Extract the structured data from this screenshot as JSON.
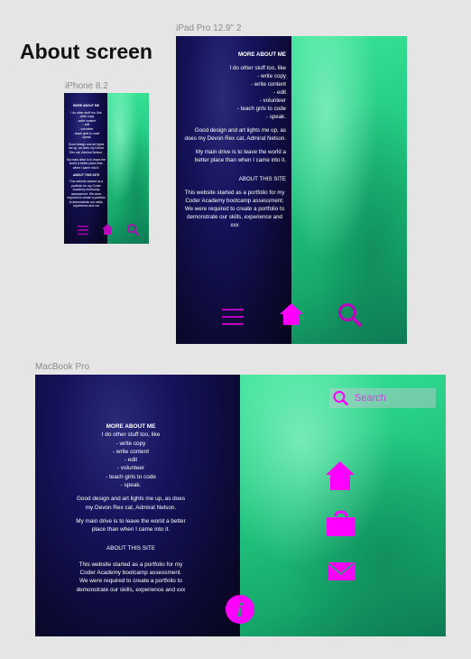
{
  "page_title": "About screen",
  "frames": {
    "iphone_label": "iPhone 8.2",
    "ipad_label": "iPad Pro 12.9\" 2",
    "macbook_label": "MacBook Pro"
  },
  "content": {
    "heading": "MORE ABOUT ME",
    "intro": "I do other stuff too, like",
    "list": [
      "- write copy",
      "- write content",
      "- edit",
      "- volunteer",
      "- teach girls to code",
      "- speak."
    ],
    "para_design": "Good design and art lights me up, as does my Devon Rex cat, Admiral Nelson.",
    "para_drive": "My main drive is to leave the world a better place than when I came into it.",
    "site_heading": "ABOUT THIS SITE",
    "site_para_ipad": "This website started as a portfolio for my Coder Academy bootcamp assessment. We were required to create a portfolio to demonstrate our skills, experience and xxx",
    "site_para_mac": "This website started as a portfolio for my Coder Academy bootcamp assessment. We were required to create a portfolio to demonstrate our skills, experience and xxx"
  },
  "search": {
    "placeholder": "Search"
  },
  "colors": {
    "accent": "#ff00ff",
    "accent_dark": "#c000c0",
    "bg": "#e5e5e5"
  },
  "icons": [
    "hamburger-menu-icon",
    "home-icon",
    "search-icon",
    "briefcase-icon",
    "mail-icon",
    "info-icon"
  ]
}
